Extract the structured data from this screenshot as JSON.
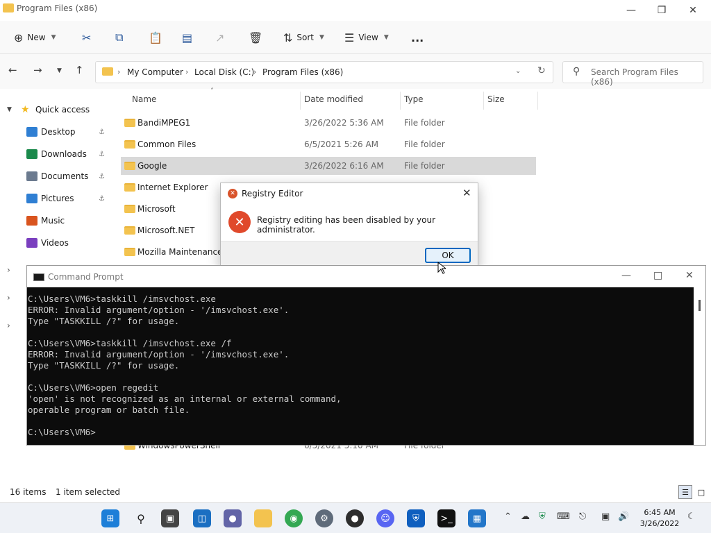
{
  "explorer": {
    "title": "Program Files (x86)",
    "toolbar": {
      "new": "New",
      "sort": "Sort",
      "view": "View",
      "more": "..."
    },
    "breadcrumb": [
      "My Computer",
      "Local Disk (C:)",
      "Program Files (x86)"
    ],
    "search_placeholder": "Search Program Files (x86)",
    "columns": {
      "name": "Name",
      "date": "Date modified",
      "type": "Type",
      "size": "Size"
    },
    "sidebar": {
      "quick_access": "Quick access",
      "items": [
        {
          "label": "Desktop",
          "icon": "desktop-icon",
          "color": "#2f7fd3"
        },
        {
          "label": "Downloads",
          "icon": "download-icon",
          "color": "#1b8a4c"
        },
        {
          "label": "Documents",
          "icon": "documents-icon",
          "color": "#6b7a8f"
        },
        {
          "label": "Pictures",
          "icon": "pictures-icon",
          "color": "#2f7fd3"
        },
        {
          "label": "Music",
          "icon": "music-icon",
          "color": "#d9541e"
        },
        {
          "label": "Videos",
          "icon": "videos-icon",
          "color": "#7a3fbf"
        }
      ]
    },
    "files": [
      {
        "name": "BandiMPEG1",
        "date": "3/26/2022 5:36 AM",
        "type": "File folder"
      },
      {
        "name": "Common Files",
        "date": "6/5/2021 5:26 AM",
        "type": "File folder"
      },
      {
        "name": "Google",
        "date": "3/26/2022 6:16 AM",
        "type": "File folder"
      },
      {
        "name": "Internet Explorer",
        "date": "",
        "type": ""
      },
      {
        "name": "Microsoft",
        "date": "",
        "type": ""
      },
      {
        "name": "Microsoft.NET",
        "date": "",
        "type": ""
      },
      {
        "name": "Mozilla Maintenance S",
        "date": "",
        "type": ""
      },
      {
        "name": "WindowsPowerShell",
        "date": "6/5/2021 5:10 AM",
        "type": "File folder"
      }
    ],
    "status": {
      "count": "16 items",
      "selected": "1 item selected"
    }
  },
  "dialog": {
    "title": "Registry Editor",
    "message": "Registry editing has been disabled by your administrator.",
    "ok": "OK"
  },
  "cmd": {
    "title": "Command Prompt",
    "lines": [
      "C:\\Users\\VM6>taskkill /imsvchost.exe",
      "ERROR: Invalid argument/option - '/imsvchost.exe'.",
      "Type \"TASKKILL /?\" for usage.",
      "",
      "C:\\Users\\VM6>taskkill /imsvchost.exe /f",
      "ERROR: Invalid argument/option - '/imsvchost.exe'.",
      "Type \"TASKKILL /?\" for usage.",
      "",
      "C:\\Users\\VM6>open regedit",
      "'open' is not recognized as an internal or external command,",
      "operable program or batch file.",
      "",
      "C:\\Users\\VM6>"
    ]
  },
  "taskbar": {
    "time": "6:45 AM",
    "date": "3/26/2022"
  }
}
